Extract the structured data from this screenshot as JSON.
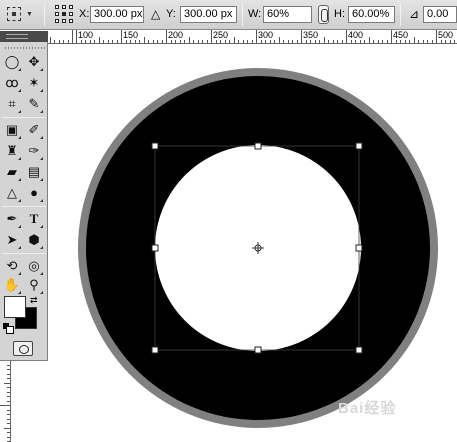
{
  "options_bar": {
    "x_label": "X:",
    "x_value": "300.00 px",
    "y_label": "Y:",
    "y_value": "300.00 px",
    "w_label": "W:",
    "w_value": "60%",
    "h_label": "H:",
    "h_value": "60.00%",
    "rotate_value": "0.00"
  },
  "ruler": {
    "labels": [
      "100",
      "150",
      "200",
      "250",
      "300",
      "350",
      "400",
      "450",
      "500"
    ]
  },
  "canvas": {
    "ring_color": "#808080",
    "disc_color": "#000000",
    "inner_color": "#ffffff"
  },
  "colors": {
    "foreground": "#ffffff",
    "background": "#000000"
  },
  "watermark": "Bai经验"
}
